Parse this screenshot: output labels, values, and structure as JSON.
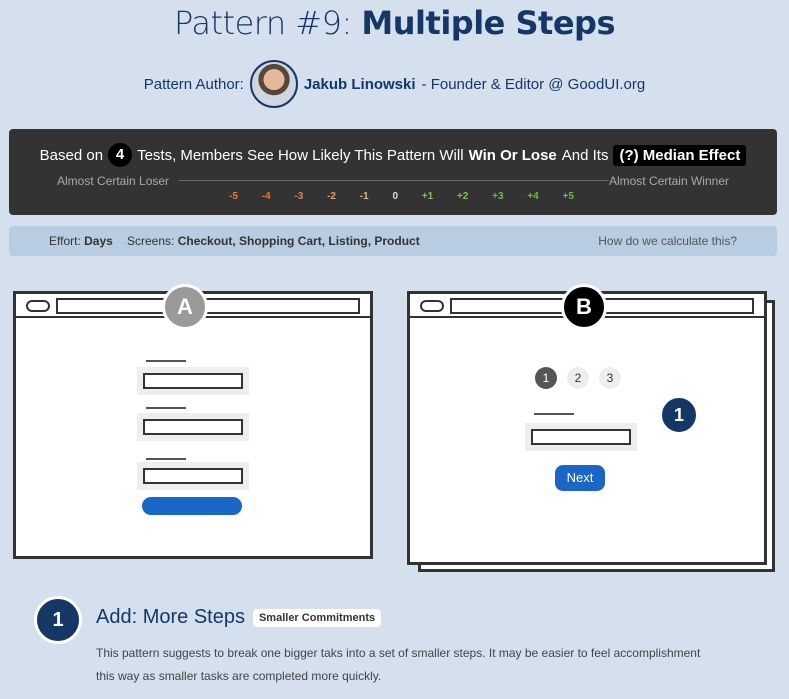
{
  "title_prefix": "Pattern #9:",
  "title_main": "Multiple Steps",
  "author": {
    "label": "Pattern Author:",
    "name": "Jakub Linowski",
    "role": "- Founder & Editor @ GoodUI.org"
  },
  "summary": {
    "prefix": "Based on",
    "count": "4",
    "text": "Tests, Members See How Likely This Pattern Will",
    "emphasis": "Win Or Lose",
    "suffix": "And Its",
    "median_button": "(?) Median Effect"
  },
  "scale": {
    "left_label": "Almost Certain Loser",
    "right_label": "Almost Certain Winner",
    "ticks": [
      "-5",
      "-4",
      "-3",
      "-2",
      "-1",
      "0",
      "+1",
      "+2",
      "+3",
      "+4",
      "+5"
    ],
    "tick_colors": [
      "#e07a3a",
      "#e07a3a",
      "#e0823f",
      "#e29a5c",
      "#e0b090",
      "#dddddd",
      "#7bc34b",
      "#7bc34b",
      "#6abb3a",
      "#6abb3a",
      "#6abb3a"
    ]
  },
  "info": {
    "effort_label": "Effort:",
    "effort_value": "Days",
    "screens_label": "Screens:",
    "screens_value": "Checkout, Shopping Cart, Listing, Product",
    "how_link": "How do we calculate this?"
  },
  "variants": {
    "a_label": "A",
    "b_label": "B",
    "steps": [
      "1",
      "2",
      "3"
    ],
    "next_label": "Next",
    "marker": "1"
  },
  "step": {
    "number": "1",
    "title": "Add: More Steps",
    "tag": "Smaller Commitments",
    "description": "This pattern suggests to break one bigger taks into a set of smaller steps. It may be easier to feel accomplishment this way as smaller tasks are completed more quickly."
  }
}
